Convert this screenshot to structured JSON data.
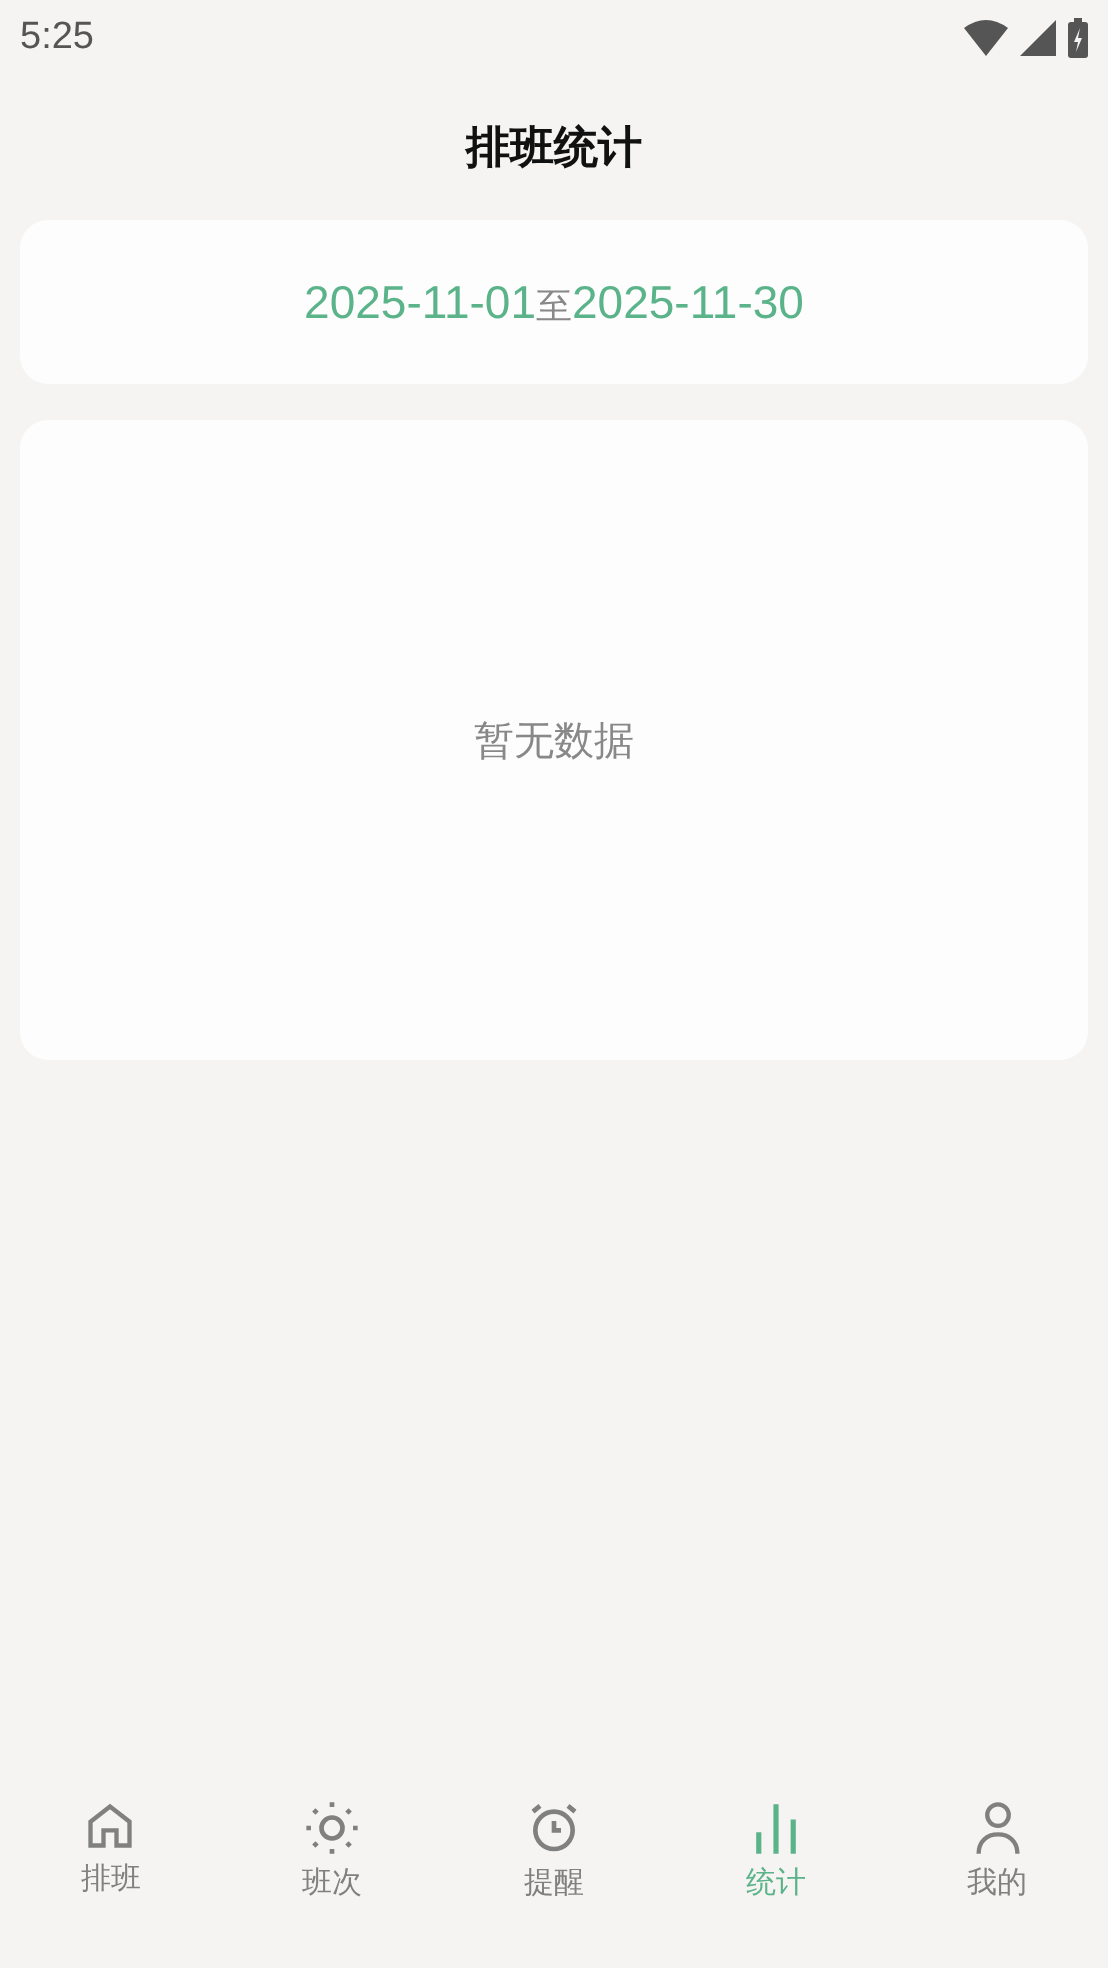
{
  "status_bar": {
    "time": "5:25"
  },
  "title": "排班统计",
  "date_range": {
    "start": "2025-11-01",
    "separator": "至",
    "end": "2025-11-30"
  },
  "empty_state": "暂无数据",
  "tabs": [
    {
      "kind": "home",
      "label": "排班",
      "selected": false
    },
    {
      "kind": "sun",
      "label": "班次",
      "selected": false
    },
    {
      "kind": "alarm",
      "label": "提醒",
      "selected": false
    },
    {
      "kind": "chart",
      "label": "统计",
      "selected": true
    },
    {
      "kind": "person",
      "label": "我的",
      "selected": false
    }
  ]
}
